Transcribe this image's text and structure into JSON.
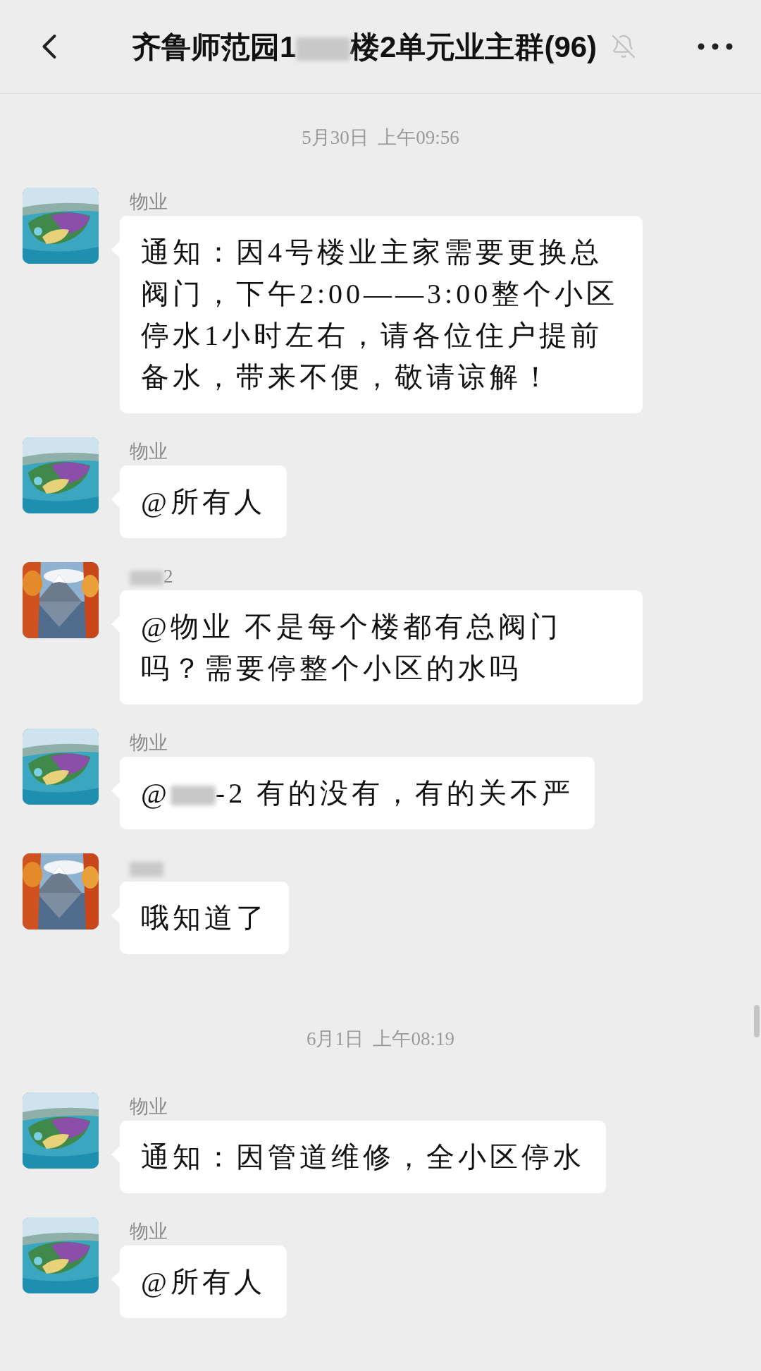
{
  "header": {
    "title_parts": [
      {
        "kind": "text",
        "text": "齐鲁师范园1"
      },
      {
        "kind": "blur"
      },
      {
        "kind": "text",
        "text": "楼2单元业主群(96)"
      }
    ],
    "muted": true
  },
  "timeline": [
    {
      "kind": "date",
      "text": "5月30日  上午09:56"
    },
    {
      "kind": "message",
      "sender_parts": [
        {
          "kind": "text",
          "text": "物业"
        }
      ],
      "parts": [
        {
          "kind": "text",
          "text": "通知：因4号楼业主家需要更换总阀门，下午2:00——3:00整个小区停水1小时左右，请各位住户提前备水，带来不便，敬请谅解！"
        }
      ]
    },
    {
      "kind": "message",
      "sender_parts": [
        {
          "kind": "text",
          "text": "物业"
        }
      ],
      "parts": [
        {
          "kind": "text",
          "text": "@所有人"
        }
      ]
    },
    {
      "kind": "message",
      "sender_parts": [
        {
          "kind": "blur"
        },
        {
          "kind": "text",
          "text": "2"
        }
      ],
      "parts": [
        {
          "kind": "text",
          "text": "@物业  不是每个楼都有总阀门吗？需要停整个小区的水吗"
        }
      ]
    },
    {
      "kind": "message",
      "sender_parts": [
        {
          "kind": "text",
          "text": "物业"
        }
      ],
      "parts": [
        {
          "kind": "text",
          "text": "@"
        },
        {
          "kind": "blur"
        },
        {
          "kind": "text",
          "text": "-2 有的没有，有的关不严"
        }
      ]
    },
    {
      "kind": "message",
      "sender_parts": [
        {
          "kind": "blur"
        }
      ],
      "parts": [
        {
          "kind": "text",
          "text": "哦知道了"
        }
      ]
    },
    {
      "kind": "date",
      "text": "6月1日  上午08:19"
    },
    {
      "kind": "message",
      "sender_parts": [
        {
          "kind": "text",
          "text": "物业"
        }
      ],
      "parts": [
        {
          "kind": "text",
          "text": "通知：因管道维修，全小区停水"
        }
      ]
    },
    {
      "kind": "message",
      "sender_parts": [
        {
          "kind": "text",
          "text": "物业"
        }
      ],
      "parts": [
        {
          "kind": "text",
          "text": "@所有人"
        }
      ]
    }
  ]
}
